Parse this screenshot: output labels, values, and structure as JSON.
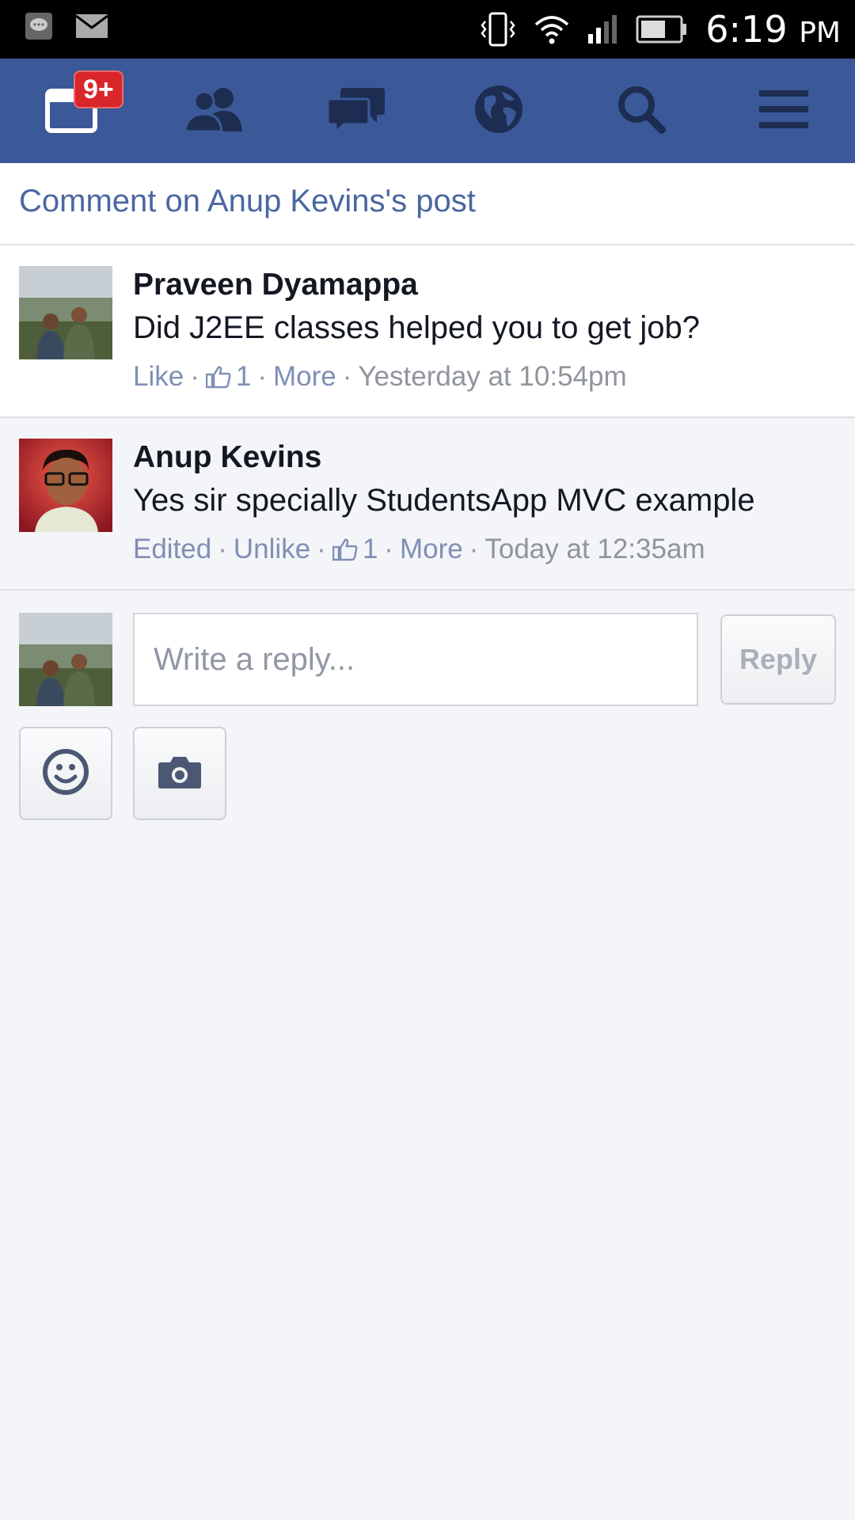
{
  "status_bar": {
    "time": "6:19",
    "ampm": "PM",
    "icons": [
      "message-icon",
      "gmail-icon",
      "vibrate-icon",
      "wifi-icon",
      "signal-icon",
      "battery-icon"
    ]
  },
  "nav": {
    "items": [
      "notifications-icon",
      "friends-icon",
      "messages-icon",
      "globe-icon",
      "search-icon",
      "menu-icon"
    ],
    "notification_badge": "9+",
    "colors": {
      "bar": "#3b5998",
      "icon": "#1d2d52",
      "active_icon": "#ffffff",
      "badge": "#d8262a"
    }
  },
  "header": {
    "title": "Comment on Anup Kevins's post"
  },
  "comments": [
    {
      "name": "Praveen Dyamappa",
      "text": "Did J2EE classes helped you to get job?",
      "actions": {
        "like": "Like",
        "like_count": "1",
        "more": "More",
        "sep": "·",
        "time": "Yesterday at 10:54pm"
      }
    },
    {
      "name": "Anup Kevins",
      "text": "Yes sir specially StudentsApp MVC example",
      "actions": {
        "edited": "Edited",
        "unlike": "Unlike",
        "like_count": "1",
        "more": "More",
        "sep": "·",
        "time": "Today at 12:35am"
      }
    }
  ],
  "reply": {
    "placeholder": "Write a reply...",
    "button": "Reply",
    "tools": [
      "emoji-icon",
      "camera-icon"
    ]
  }
}
